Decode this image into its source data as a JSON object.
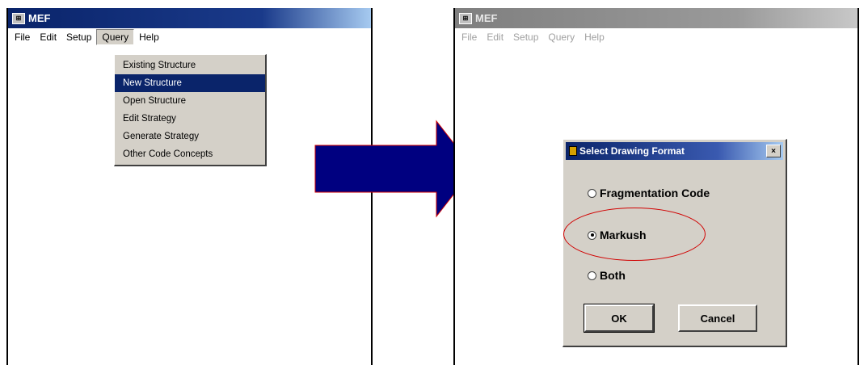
{
  "left_window": {
    "title": "MEF",
    "menu": [
      "File",
      "Edit",
      "Setup",
      "Query",
      "Help"
    ],
    "query_menu": {
      "items": [
        "Existing Structure",
        "New Structure",
        "Open Structure",
        "Edit Strategy",
        "Generate Strategy",
        "Other Code Concepts"
      ],
      "selected": "New Structure"
    }
  },
  "right_window": {
    "title": "MEF",
    "menu": [
      "File",
      "Edit",
      "Setup",
      "Query",
      "Help"
    ]
  },
  "dialog": {
    "title": "Select Drawing Format",
    "close_glyph": "×",
    "options": [
      {
        "label": "Fragmentation Code",
        "selected": false
      },
      {
        "label": "Markush",
        "selected": true
      },
      {
        "label": "Both",
        "selected": false
      }
    ],
    "ok_label": "OK",
    "cancel_label": "Cancel"
  },
  "colors": {
    "active_title": "#0a246a",
    "arrow_fill": "#000080",
    "arrow_stroke": "#d10000",
    "highlight_circle": "#d10000",
    "menu_selection": "#0a246a"
  },
  "icons": [
    "app-icon",
    "dialog-app-icon",
    "close-icon",
    "right-arrow-icon"
  ]
}
